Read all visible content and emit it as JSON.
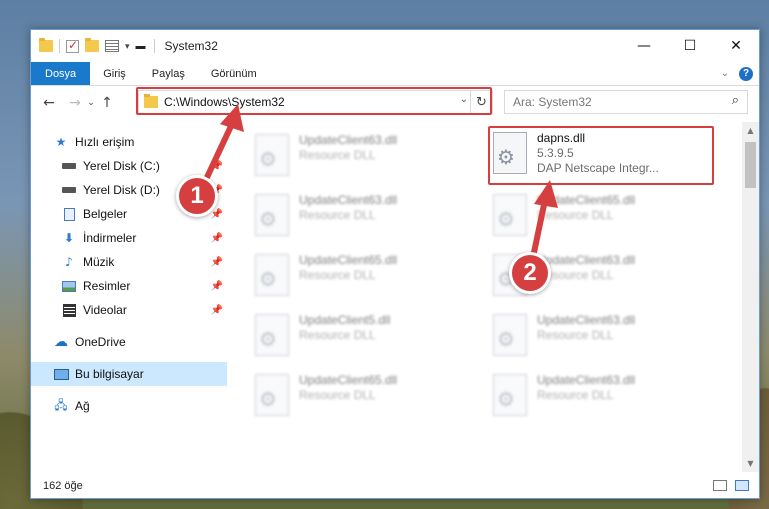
{
  "window": {
    "title": "System32",
    "controls": {
      "minimize": "—",
      "maximize": "☐",
      "close": "✕"
    }
  },
  "ribbon": {
    "tabs": [
      "Dosya",
      "Giriş",
      "Paylaş",
      "Görünüm"
    ]
  },
  "navbar": {
    "address": "C:\\Windows\\System32",
    "search_placeholder": "Ara: System32"
  },
  "sidebar": {
    "items": [
      {
        "label": "Hızlı erişim",
        "icon": "star-icon",
        "level": 0
      },
      {
        "label": "Yerel Disk (C:)",
        "icon": "drive-icon",
        "level": 1,
        "pinned": true
      },
      {
        "label": "Yerel Disk (D:)",
        "icon": "drive-icon",
        "level": 1,
        "pinned": true
      },
      {
        "label": "Belgeler",
        "icon": "documents-icon",
        "level": 1,
        "pinned": true
      },
      {
        "label": "İndirmeler",
        "icon": "download-icon",
        "level": 1,
        "pinned": true
      },
      {
        "label": "Müzik",
        "icon": "music-icon",
        "level": 1,
        "pinned": true
      },
      {
        "label": "Resimler",
        "icon": "pictures-icon",
        "level": 1,
        "pinned": true
      },
      {
        "label": "Videolar",
        "icon": "videos-icon",
        "level": 1,
        "pinned": true
      },
      {
        "label": "OneDrive",
        "icon": "cloud-icon",
        "level": 0
      },
      {
        "label": "Bu bilgisayar",
        "icon": "computer-icon",
        "level": 0,
        "selected": true
      },
      {
        "label": "Ağ",
        "icon": "network-icon",
        "level": 0
      }
    ]
  },
  "files": {
    "highlighted": {
      "name": "dapns.dll",
      "version": "5.3.9.5",
      "description": "DAP Netscape Integr..."
    },
    "left_column": [
      {
        "name": "UpdateClient63.dll",
        "type": "Resource DLL"
      },
      {
        "name": "UpdateClient63.dll",
        "type": "Resource DLL"
      },
      {
        "name": "UpdateClient65.dll",
        "type": "Resource DLL"
      },
      {
        "name": "UpdateClient5.dll",
        "type": "Resource DLL"
      },
      {
        "name": "UpdateClient65.dll",
        "type": "Resource DLL"
      }
    ],
    "right_column": [
      {
        "name": "UpdateClient65.dll",
        "type": "Resource DLL"
      },
      {
        "name": "UpdateClient63.dll",
        "type": "Resource DLL"
      },
      {
        "name": "UpdateClient63.dll",
        "type": "Resource DLL"
      },
      {
        "name": "UpdateClient63.dll",
        "type": "Resource DLL"
      }
    ]
  },
  "status": {
    "count": "162 öğe"
  },
  "annotations": {
    "step1": "1",
    "step2": "2",
    "color": "#d63f3f"
  }
}
